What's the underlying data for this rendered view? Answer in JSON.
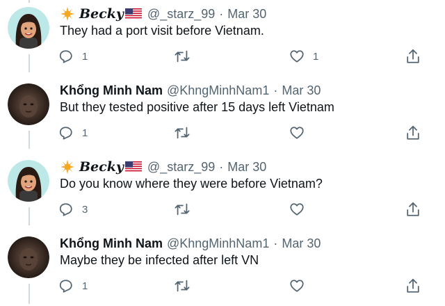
{
  "tweets": [
    {
      "display_name": "Becky",
      "handle": "@_starz_99",
      "date": "Mar 30",
      "text": "They had a port visit before Vietnam.",
      "reply_count": "1",
      "retweet_count": "",
      "like_count": "1"
    },
    {
      "display_name": "Khổng Minh Nam",
      "handle": "@KhngMinhNam1",
      "date": "Mar 30",
      "text": "But they tested positive after 15 days left Vietnam",
      "reply_count": "1",
      "retweet_count": "",
      "like_count": ""
    },
    {
      "display_name": "Becky",
      "handle": "@_starz_99",
      "date": "Mar 30",
      "text": "Do you know where they were before Vietnam?",
      "reply_count": "3",
      "retweet_count": "",
      "like_count": ""
    },
    {
      "display_name": "Khổng Minh Nam",
      "handle": "@KhngMinhNam1",
      "date": "Mar 30",
      "text": "Maybe they be infected after left VN",
      "reply_count": "1",
      "retweet_count": "",
      "like_count": ""
    }
  ],
  "separator": "·",
  "icons": {
    "reply": "reply-icon",
    "retweet": "retweet-icon",
    "like": "heart-icon",
    "share": "share-icon",
    "badge": "star-icon",
    "flag": "us-flag-icon"
  },
  "colors": {
    "text": "#0f1419",
    "secondary": "#536471",
    "thread_line": "#cfd9de",
    "star": "#f5a623"
  }
}
